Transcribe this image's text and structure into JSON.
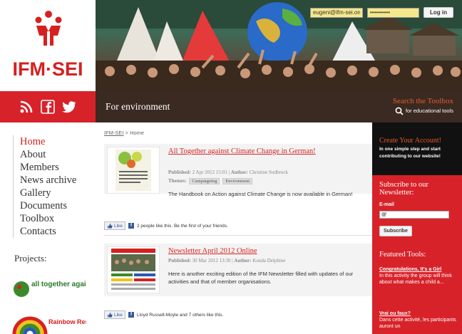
{
  "logo": {
    "text": "IFM·SEI"
  },
  "social_icons": [
    "rss-icon",
    "facebook-icon",
    "twitter-icon"
  ],
  "nav": {
    "items": [
      {
        "label": "Home",
        "active": true
      },
      {
        "label": "About"
      },
      {
        "label": "Members"
      },
      {
        "label": "News archive"
      },
      {
        "label": "Gallery"
      },
      {
        "label": "Documents"
      },
      {
        "label": "Toolbox"
      },
      {
        "label": "Contacts"
      }
    ]
  },
  "projects": {
    "label": "Projects:",
    "items": [
      "all together against climate change",
      "Rainbow Resources"
    ]
  },
  "login": {
    "email_value": "eugeni@ifm-sei.org",
    "password_value": "••••••••••",
    "button": "Log in"
  },
  "banner": {
    "caption": "For environment"
  },
  "toolbox": {
    "title": "Search the Toolbox",
    "subtitle": "for educational tools"
  },
  "breadcrumb": {
    "root": "IFM-SEI",
    "sep": " > ",
    "current": "Home"
  },
  "articles": [
    {
      "title": "All Together against Climate Change in German!",
      "published_label": "Published:",
      "published": "2 Apr 2012 15:01",
      "author_label": "Author:",
      "author": "Christine Sudbrock",
      "themes_label": "Themes:",
      "themes": [
        "Campaigning",
        "Environment"
      ],
      "text": "The Handbook on Action against Climate Change is now available in German!",
      "like_label": "Like",
      "like_text": "2 people like this. Be the first of your friends."
    },
    {
      "title": "Newsletter April 2012 Online",
      "published_label": "Published:",
      "published": "30 Mar 2012 13:30",
      "author_label": "Author:",
      "author": "Konda Delphine",
      "text": "Here is another exciting edition of the IFM Newsletter filled with updates of our activities and that of member organisations.",
      "like_label": "Like",
      "like_text": "Lloyd Russell-Moyle and 7 others like this."
    }
  ],
  "sidebar": {
    "create_title": "Create Your Account!",
    "create_text": "In one simple step and start contributing to our website!",
    "subscribe_title": "Subscribe to our Newsletter:",
    "email_label": "E-mail",
    "email_value": "@",
    "subscribe_button": "Subscribe",
    "featured_title": "Featured Tools:",
    "tools": [
      {
        "title": "Congratulations, It's a Girl",
        "text": "In this activity the group will think about what makes a child a..."
      },
      {
        "title": "Vrai ou faux?",
        "text": "Dans cette activité, les participants auront un"
      }
    ]
  },
  "colors": {
    "brand_red": "#d8222a",
    "dark": "#111111",
    "accent_orange": "#e85a2a"
  }
}
